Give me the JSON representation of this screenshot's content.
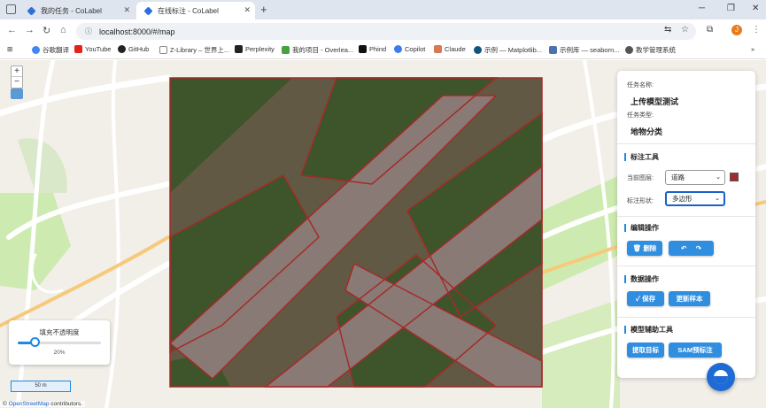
{
  "browser": {
    "tabs": [
      {
        "label": "我的任务 - CoLabel",
        "active": false
      },
      {
        "label": "在线标注 - CoLabel",
        "active": true
      }
    ],
    "url": "localhost:8000/#/map",
    "avatar_letter": "J",
    "bookmarks": [
      "谷歌翻译",
      "YouTube",
      "GitHub",
      "Z-Library – 世界上...",
      "Perplexity",
      "我的项目 - Overlea...",
      "Phind",
      "Copilot",
      "Claude",
      "示例 — Matplotlib...",
      "示例库 — seaborn...",
      "教学管理系统"
    ]
  },
  "map": {
    "zoom_in": "+",
    "zoom_out": "−",
    "opacity_title": "填充不透明度",
    "opacity_value": "20%",
    "opacity_level": 0.2,
    "scale_label": "50 m",
    "attribution_prefix": "© ",
    "attribution_link": "OpenStreetMap",
    "attribution_suffix": " contributors."
  },
  "panel": {
    "task_name_label": "任务名称:",
    "task_name": "上传模型测试",
    "task_type_label": "任务类型:",
    "task_type": "地物分类",
    "tools_title": "标注工具",
    "layer_label": "当前图层:",
    "layer_value": "道路",
    "layer_color": "#a52a2a",
    "shape_label": "标注形状:",
    "shape_value": "多边形",
    "edit_title": "编辑操作",
    "delete_label": "删除",
    "undo_glyph": "↶",
    "redo_glyph": "↷",
    "data_title": "数据操作",
    "save_label": "保存",
    "update_sample_label": "更新样本",
    "assist_title": "模型辅助工具",
    "extract_label": "提取目标",
    "sam_label": "SAM预标注"
  },
  "colors": {
    "accent": "#2f8ee0",
    "annotation": "#a52a2a"
  }
}
